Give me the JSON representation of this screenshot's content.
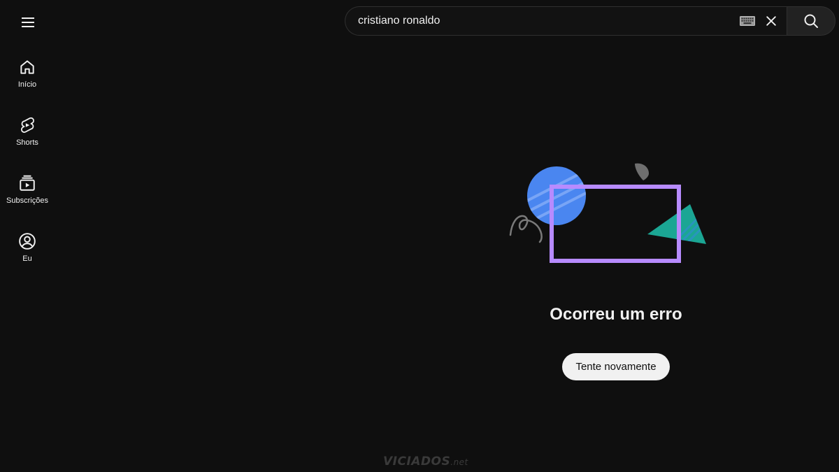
{
  "sidebar": {
    "items": [
      {
        "label": "Início",
        "icon": "home-icon"
      },
      {
        "label": "Shorts",
        "icon": "shorts-icon"
      },
      {
        "label": "Subscrições",
        "icon": "subscriptions-icon"
      },
      {
        "label": "Eu",
        "icon": "account-icon"
      }
    ]
  },
  "header": {
    "menu_icon": "hamburger-menu-icon"
  },
  "search": {
    "value": "cristiano ronaldo",
    "keyboard_icon": "keyboard-icon",
    "clear_icon": "close-icon",
    "submit_icon": "search-icon"
  },
  "error": {
    "title": "Ocorreu um erro",
    "retry_label": "Tente novamente"
  },
  "watermark": {
    "main": "VICIADOS",
    "suffix": ".net"
  },
  "colors": {
    "background": "#0f0f0f",
    "text": "#f1f1f1",
    "circle_blue": "#4285f4",
    "frame_purple": "#b388ff",
    "triangle_teal": "#1ba694",
    "retry_button_bg": "#f1f1f1"
  }
}
